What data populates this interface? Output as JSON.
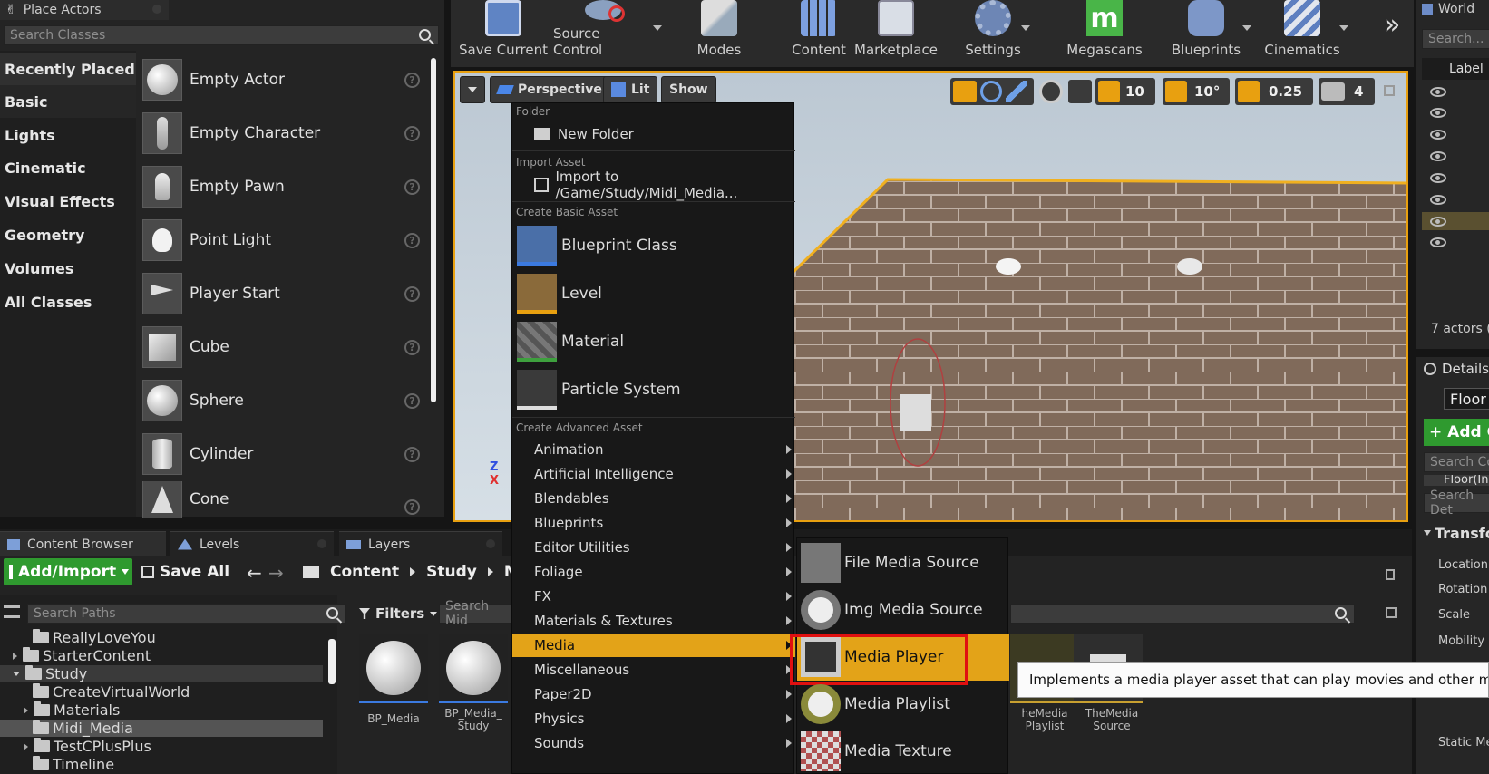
{
  "place_actors": {
    "tab_title": "Place Actors",
    "search_placeholder": "Search Classes",
    "categories": [
      "Recently Placed",
      "Basic",
      "Lights",
      "Cinematic",
      "Visual Effects",
      "Geometry",
      "Volumes",
      "All Classes"
    ],
    "actors": [
      "Empty Actor",
      "Empty Character",
      "Empty Pawn",
      "Point Light",
      "Player Start",
      "Cube",
      "Sphere",
      "Cylinder",
      "Cone"
    ],
    "help_glyph": "?"
  },
  "toolbar": {
    "buttons": [
      "Save Current",
      "Source Control",
      "Modes",
      "Content",
      "Marketplace",
      "Settings",
      "Megascans",
      "Blueprints",
      "Cinematics"
    ],
    "overflow": "»",
    "megascans_letter": "m"
  },
  "viewport": {
    "perspective": "Perspective",
    "lit": "Lit",
    "show": "Show",
    "grid_snap": "10",
    "rotation_snap": "10°",
    "scale_snap": "0.25",
    "camera_speed": "4"
  },
  "context_menu": {
    "folder_header": "Folder",
    "new_folder": "New Folder",
    "import_header": "Import Asset",
    "import_to": "Import to /Game/Study/Midi_Media...",
    "basic_header": "Create Basic Asset",
    "basic_items": [
      "Blueprint Class",
      "Level",
      "Material",
      "Particle System"
    ],
    "advanced_header": "Create Advanced Asset",
    "advanced_items": [
      "Animation",
      "Artificial Intelligence",
      "Blendables",
      "Blueprints",
      "Editor Utilities",
      "Foliage",
      "FX",
      "Materials & Textures",
      "Media",
      "Miscellaneous",
      "Paper2D",
      "Physics",
      "Sounds"
    ],
    "highlighted": "Media"
  },
  "media_submenu": {
    "items": [
      "File Media Source",
      "Img Media Source",
      "Media Player",
      "Media Playlist",
      "Media Texture"
    ],
    "selected": "Media Player",
    "tooltip": "Implements a media player asset that can play movies and other media so"
  },
  "bottom_tabs": [
    "Content Browser",
    "Levels",
    "Layers"
  ],
  "content_browser": {
    "add_import": "Add/Import",
    "save_all": "Save All",
    "breadcrumb": [
      "Content",
      "Study",
      "M"
    ],
    "search_paths": "Search Paths",
    "filters": "Filters",
    "search_assets": "Search Mid",
    "tree": [
      {
        "label": "ReallyLoveYou",
        "indent": 1,
        "expand": false
      },
      {
        "label": "StarterContent",
        "indent": 0,
        "expand": true
      },
      {
        "label": "Study",
        "indent": 0,
        "expand": true,
        "open": true
      },
      {
        "label": "CreateVirtualWorld",
        "indent": 1,
        "expand": false
      },
      {
        "label": "Materials",
        "indent": 1,
        "expand": true
      },
      {
        "label": "Midi_Media",
        "indent": 1,
        "expand": false,
        "selected": true
      },
      {
        "label": "TestCPlusPlus",
        "indent": 1,
        "expand": true
      },
      {
        "label": "Timeline",
        "indent": 1,
        "expand": false
      }
    ],
    "assets": [
      {
        "name": "BP_Media"
      },
      {
        "name": "BP_Media_\nStudy"
      }
    ],
    "right_assets": [
      "heMedia\nPlaylist",
      "TheMedia\nSource"
    ]
  },
  "world_outliner": {
    "title": "World",
    "search_placeholder": "Search...",
    "label_col": "Label",
    "actor_count": "7 actors ("
  },
  "details": {
    "title": "Details",
    "selected": "Floor",
    "add_component": "+ Add Co",
    "search_components": "Search Co",
    "floor_row": "Floor(In",
    "search_details": "Search Det",
    "transform": "Transfor",
    "fields": [
      "Location",
      "Rotation",
      "Scale",
      "Mobility"
    ],
    "static_mesh": "Static Mes"
  }
}
